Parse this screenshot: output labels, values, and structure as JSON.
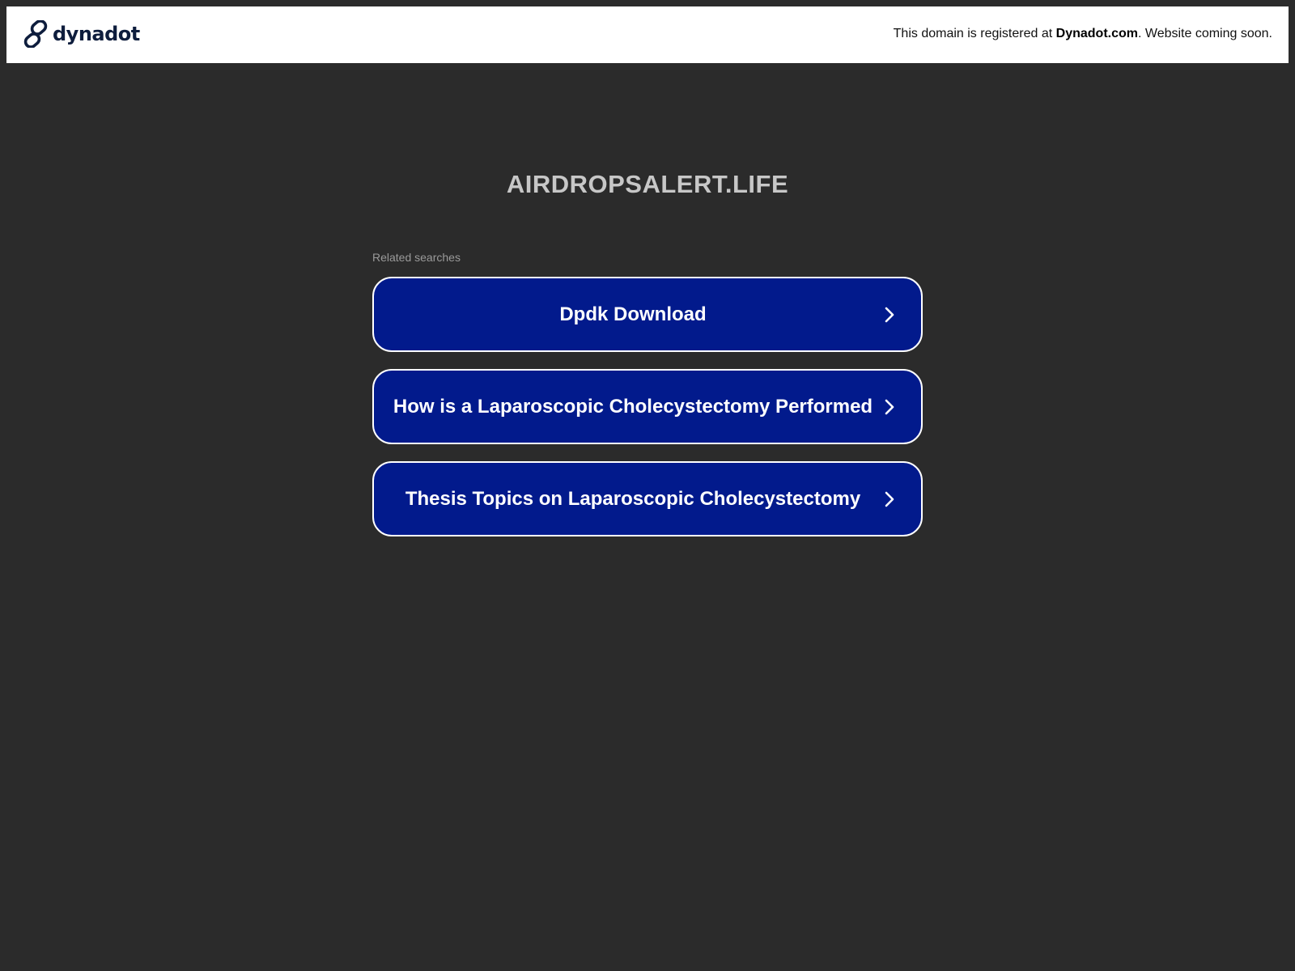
{
  "header": {
    "logo_text": "dynadot",
    "notice_prefix": "This domain is registered at ",
    "notice_link": "Dynadot.com",
    "notice_suffix": ". Website coming soon."
  },
  "main": {
    "domain_title": "AIRDROPSALERT.LIFE",
    "related_label": "Related searches",
    "searches": [
      {
        "label": "Dpdk Download"
      },
      {
        "label": "How is a Laparoscopic Cholecystectomy Performed"
      },
      {
        "label": "Thesis Topics on Laparoscopic Cholecystectomy"
      }
    ]
  },
  "icons": {
    "logo": "chain-link-icon",
    "search_arrow": "chevron-right-icon"
  },
  "colors": {
    "background": "#2b2b2b",
    "header_bg": "#ffffff",
    "button_bg": "#021a8c",
    "button_border": "#ffffff",
    "title_color": "#c7c7c7",
    "logo_color": "#0e1d3d"
  }
}
